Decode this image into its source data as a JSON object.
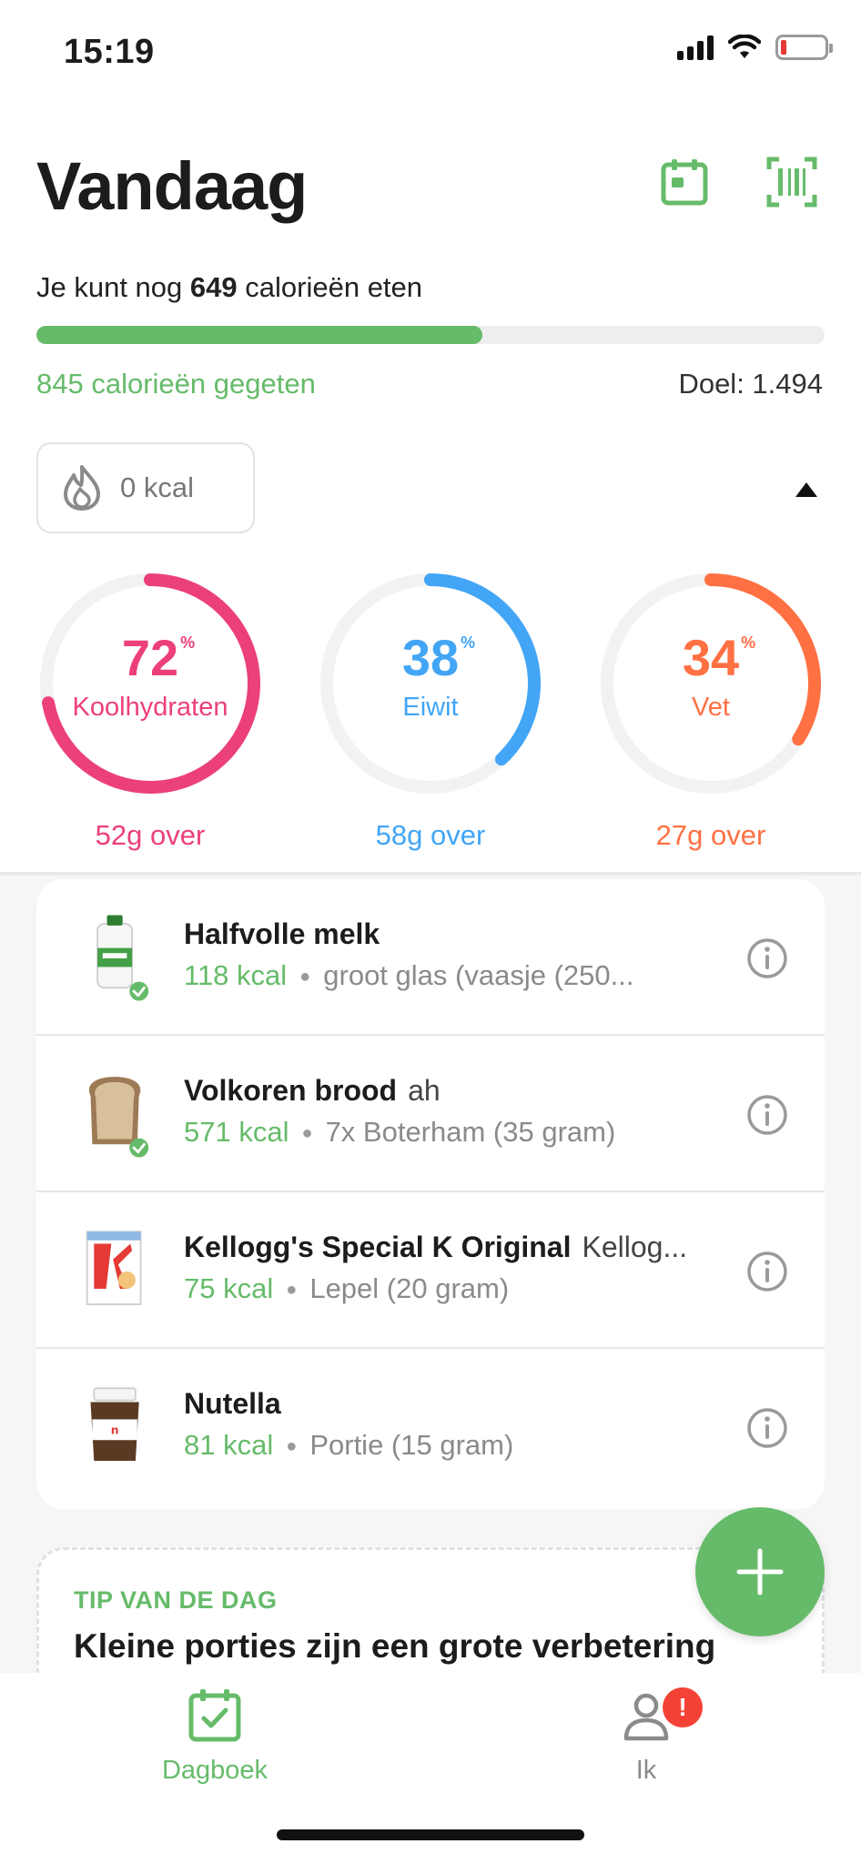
{
  "status_bar": {
    "time": "15:19"
  },
  "header": {
    "title": "Vandaag",
    "calendar_icon": "calendar-icon",
    "scanner_icon": "barcode-scanner-icon"
  },
  "summary": {
    "remaining_prefix": "Je kunt nog",
    "remaining_value": "649",
    "remaining_suffix": "calorieën eten",
    "progress_fraction": 0.566,
    "eaten_text": "845 calorieën gegeten",
    "goal_text": "Doel: 1.494",
    "burned_text": "0 kcal"
  },
  "macros": [
    {
      "percent": "72",
      "unit": "%",
      "name": "Koolhydraten",
      "left": "52g over",
      "fraction": 0.72,
      "color": "#ec407a"
    },
    {
      "percent": "38",
      "unit": "%",
      "name": "Eiwit",
      "left": "58g over",
      "fraction": 0.38,
      "color": "#42a5f5"
    },
    {
      "percent": "34",
      "unit": "%",
      "name": "Vet",
      "left": "27g over",
      "fraction": 0.34,
      "color": "#ff7043"
    }
  ],
  "foods": [
    {
      "name": "Halfvolle melk",
      "brand": "",
      "kcal": "118 kcal",
      "portion": "groot glas (vaasje (250...",
      "verified": true,
      "icon": "milk-bottle-icon"
    },
    {
      "name": "Volkoren brood",
      "brand": "ah",
      "kcal": "571 kcal",
      "portion": "7x Boterham (35 gram)",
      "verified": true,
      "icon": "bread-slice-icon"
    },
    {
      "name": "Kellogg's Special K Original",
      "brand": "Kellog...",
      "kcal": "75 kcal",
      "portion": "Lepel (20 gram)",
      "verified": false,
      "icon": "cereal-box-icon"
    },
    {
      "name": "Nutella",
      "brand": "",
      "kcal": "81 kcal",
      "portion": "Portie (15 gram)",
      "verified": false,
      "icon": "nutella-jar-icon"
    }
  ],
  "tip": {
    "label": "TIP VAN DE DAG",
    "text": "Kleine porties zijn een grote verbetering"
  },
  "tabs": [
    {
      "label": "Dagboek",
      "active": true,
      "icon": "diary-icon"
    },
    {
      "label": "Ik",
      "active": false,
      "icon": "profile-icon",
      "badge": "!"
    }
  ],
  "colors": {
    "green": "#66bb6a",
    "carbs": "#ec407a",
    "protein": "#42a5f5",
    "fat": "#ff7043",
    "badge": "#f44336"
  }
}
